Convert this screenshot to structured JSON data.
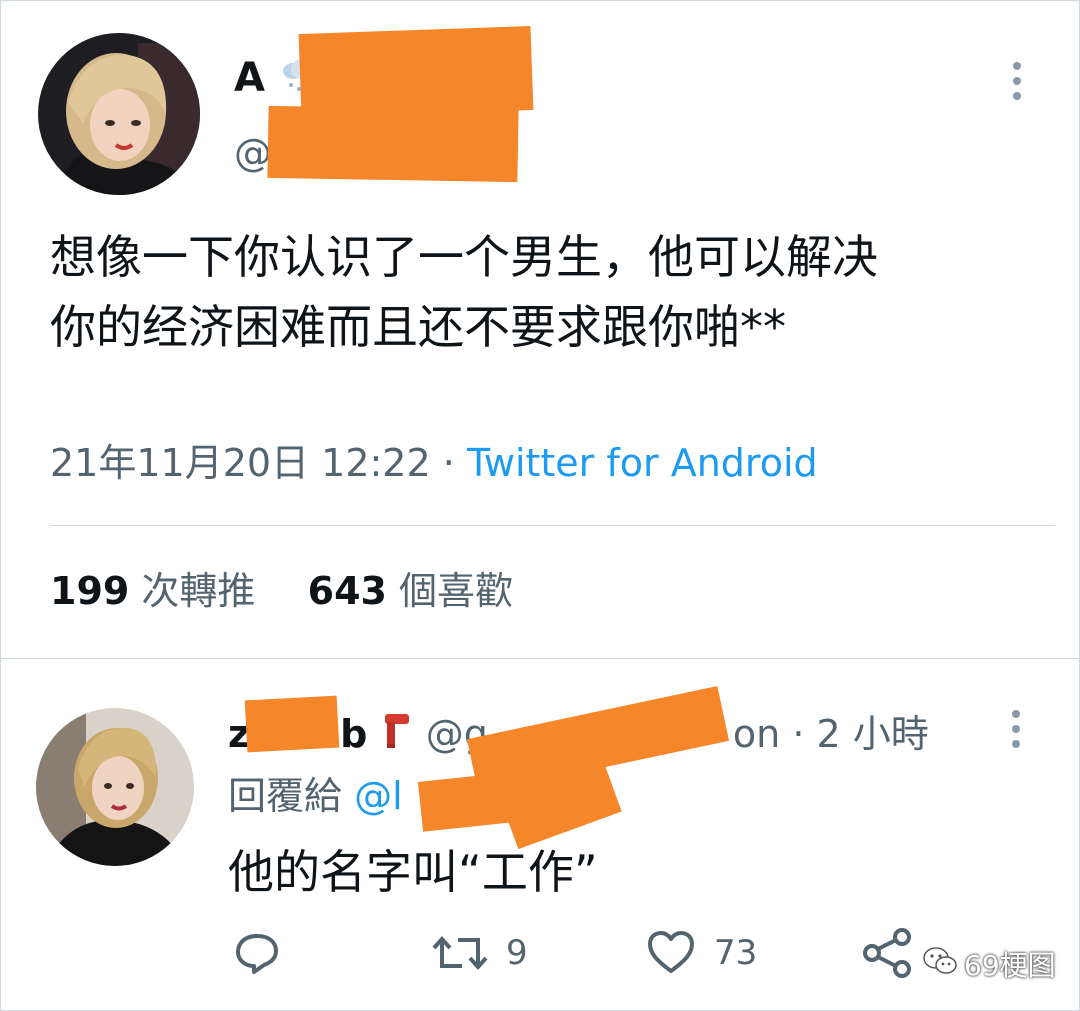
{
  "tweet": {
    "author": {
      "name_visible": "A",
      "name_emoji": "snow-cloud-icon",
      "handle_visible": "@"
    },
    "text_line1": "想像一下你认识了一个男生，他可以解决",
    "text_line2": "你的经济困难而且还不要求跟你啪**",
    "timestamp": "21年11月20日 12:22",
    "separator": "·",
    "source": "Twitter for Android",
    "retweet_count": "199",
    "retweet_label": "次轉推",
    "like_count": "643",
    "like_label": "個喜歡"
  },
  "reply": {
    "name_visible_start": "z",
    "name_visible_end": "b",
    "name_emoji": "scarf-icon",
    "handle_visible_start": "@g",
    "handle_visible_end": "on",
    "separator": "·",
    "time": "2 小時",
    "reply_to_label": "回覆給",
    "reply_to_mention": "@l",
    "text": "他的名字叫“工作”",
    "reply_count": "",
    "retweet_count": "9",
    "like_count": "73"
  },
  "watermark": {
    "text": "69梗图",
    "icon": "wechat-icon"
  },
  "colors": {
    "text": "#0f1419",
    "secondary": "#536471",
    "link": "#1d9bf0",
    "redaction": "#f5862a",
    "divider": "#cfd9de"
  }
}
